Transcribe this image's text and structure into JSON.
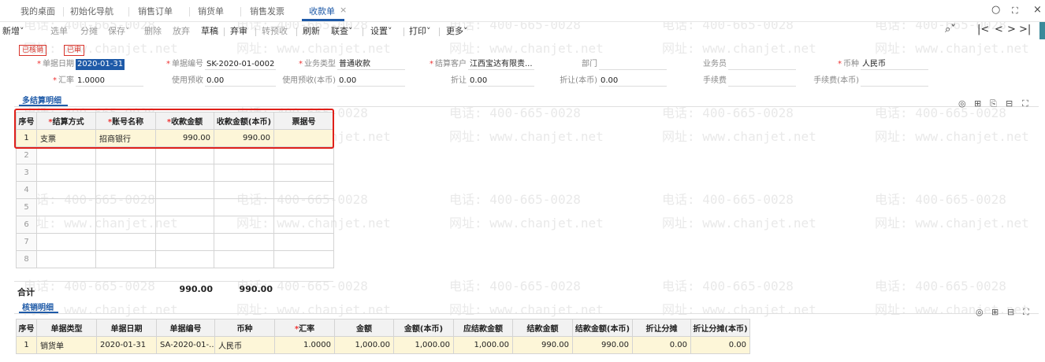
{
  "tabs": [
    "我的桌面",
    "初始化导航",
    "销售订单",
    "销货单",
    "销售发票",
    "收款单"
  ],
  "tab_close_glyph": "×",
  "window_controls": [
    "○",
    "⛶",
    "×"
  ],
  "toolbar": {
    "add": "新增˅",
    "select": "选单",
    "split": "分摊",
    "save": "保存˅",
    "delete": "删除",
    "discard": "放弃",
    "draft": "草稿",
    "abandon": "弃审",
    "to_advance": "转预收",
    "refresh": "刷新",
    "link": "联查˅",
    "settings": "设置˅",
    "print": "打印˅",
    "more": "更多˅"
  },
  "nav_buttons": [
    "⌕˅",
    "|<",
    "<",
    ">",
    ">|"
  ],
  "stamps": {
    "verified": "已核销",
    "audited": "已审"
  },
  "header": {
    "doc_date_label": "单据日期",
    "doc_date": "2020-01-31",
    "doc_no_label": "单据编号",
    "doc_no": "SK-2020-01-0002",
    "biz_type_label": "业务类型",
    "biz_type": "普通收款",
    "customer_label": "结算客户",
    "customer": "江西宝达有限责...",
    "dept_label": "部门",
    "dept": "",
    "salesman_label": "业务员",
    "salesman": "",
    "currency_label": "币种",
    "currency": "人民币",
    "rate_label": "汇率",
    "rate": "1.0000",
    "use_advance_label": "使用预收",
    "use_advance": "0.00",
    "use_advance_local_label": "使用预收(本币)",
    "use_advance_local": "0.00",
    "discount_label": "折让",
    "discount": "0.00",
    "discount_local_label": "折让(本币)",
    "discount_local": "0.00",
    "fee_label": "手续费",
    "fee": "",
    "fee_local_label": "手续费(本币)",
    "fee_local": ""
  },
  "settlement": {
    "title": "多结算明细",
    "tool_icons": [
      "◎",
      "⊞",
      "⎘",
      "⊟",
      "⛶"
    ],
    "columns": [
      "序号",
      "结算方式",
      "账号名称",
      "收款金额",
      "收款金额(本币)",
      "票据号"
    ],
    "rows": [
      {
        "idx": "1",
        "method": "支票",
        "account": "招商银行",
        "amount": "990.00",
        "amount_local": "990.00",
        "bill": ""
      },
      {
        "idx": "2"
      },
      {
        "idx": "3"
      },
      {
        "idx": "4"
      },
      {
        "idx": "5"
      },
      {
        "idx": "6"
      },
      {
        "idx": "7"
      },
      {
        "idx": "8"
      }
    ],
    "total_label": "合计",
    "total_amount": "990.00",
    "total_amount_local": "990.00"
  },
  "writeoff": {
    "title": "核销明细",
    "tool_icons": [
      "◎",
      "⊞",
      "⊟",
      "⛶"
    ],
    "columns": [
      "序号",
      "单据类型",
      "单据日期",
      "单据编号",
      "币种",
      "汇率",
      "金额",
      "金额(本币)",
      "应结款金额",
      "结款金额",
      "结款金额(本币)",
      "折让分摊",
      "折让分摊(本币)"
    ],
    "rows": [
      {
        "idx": "1",
        "type": "销货单",
        "date": "2020-01-31",
        "no": "SA-2020-01-...",
        "currency": "人民币",
        "rate": "1.0000",
        "amount": "1,000.00",
        "amount_local": "1,000.00",
        "due": "1,000.00",
        "settled": "990.00",
        "settled_local": "990.00",
        "disc": "0.00",
        "disc_local": "0.00"
      }
    ]
  },
  "watermark": {
    "phone": "电话: 400-665-0028",
    "site": "网址: www.chanjet.net"
  },
  "colors": {
    "accent": "#1e5aa8",
    "highlight_row": "#fdf6d8",
    "annotation_box": "#e0201a",
    "stamp": "#d9342b"
  }
}
